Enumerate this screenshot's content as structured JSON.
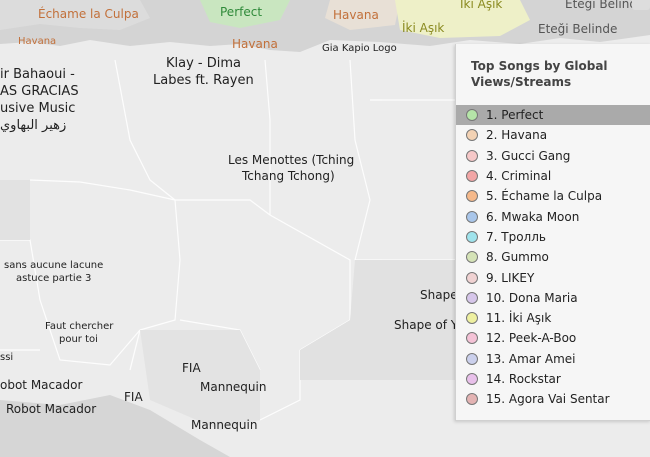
{
  "map_labels": [
    {
      "text": "Échame la Culpa",
      "color": "#c2703a"
    },
    {
      "text": "Perfect",
      "color": "#2f8a3a"
    },
    {
      "text": "Havana",
      "color": "#c2703a"
    },
    {
      "text": "İki Aşık",
      "color": "#8a8a20"
    },
    {
      "text": "Eteği Belinde",
      "color": "#555555"
    },
    {
      "text": "İki Aşık",
      "color": "#8a8a20"
    },
    {
      "text": "Eteği Belinde",
      "color": "#555555"
    },
    {
      "text": "Havana",
      "color": "#c2703a"
    },
    {
      "text": "Havana",
      "color": "#c2703a"
    },
    {
      "text": "Gia Kapio Logo",
      "color": "#222222"
    },
    {
      "text": "Klay - Dima",
      "color": "#222222"
    },
    {
      "text": "Labes ft. Rayen",
      "color": "#222222"
    },
    {
      "text": "ir Bahaoui -",
      "color": "#222222"
    },
    {
      "text": "AS GRACIAS",
      "color": "#222222"
    },
    {
      "text": "usive Music",
      "color": "#222222"
    },
    {
      "text": "زهير البهاوي",
      "color": "#222222"
    },
    {
      "text": "Les Menottes (Tching",
      "color": "#222222"
    },
    {
      "text": "Tchang Tchong)",
      "color": "#222222"
    },
    {
      "text": "sans aucune lacune",
      "color": "#222222"
    },
    {
      "text": "astuce partie 3",
      "color": "#222222"
    },
    {
      "text": "Faut chercher",
      "color": "#222222"
    },
    {
      "text": "pour toi",
      "color": "#222222"
    },
    {
      "text": "ssi",
      "color": "#222222"
    },
    {
      "text": "obot Macador",
      "color": "#222222"
    },
    {
      "text": "Robot Macador",
      "color": "#222222"
    },
    {
      "text": "FIA",
      "color": "#222222"
    },
    {
      "text": "FIA",
      "color": "#222222"
    },
    {
      "text": "Mannequin",
      "color": "#222222"
    },
    {
      "text": "Mannequin",
      "color": "#222222"
    },
    {
      "text": "Shape",
      "color": "#222222"
    },
    {
      "text": "Shape of Yo",
      "color": "#222222"
    }
  ],
  "panel": {
    "title": "Top Songs by Global Views/Streams",
    "items": [
      {
        "label": "1. Perfect",
        "color": "#b5e5a8",
        "selected": true
      },
      {
        "label": "2. Havana",
        "color": "#f3d2b4"
      },
      {
        "label": "3. Gucci Gang",
        "color": "#f6c8c8"
      },
      {
        "label": "4. Criminal",
        "color": "#f2a6a6"
      },
      {
        "label": "5. Échame la Culpa",
        "color": "#f5b98b"
      },
      {
        "label": "6. Mwaka Moon",
        "color": "#a9c6ea"
      },
      {
        "label": "7. Тролль",
        "color": "#9fe3ec"
      },
      {
        "label": "8. Gummo",
        "color": "#d5e3b7"
      },
      {
        "label": "9. LIKEY",
        "color": "#f0d2d2"
      },
      {
        "label": "10. Dona Maria",
        "color": "#d6c6ea"
      },
      {
        "label": "11. İki Aşık",
        "color": "#eef0a0"
      },
      {
        "label": "12. Peek-A-Boo",
        "color": "#f4c2d6"
      },
      {
        "label": "13. Amar Amei",
        "color": "#cbd0ec"
      },
      {
        "label": "14. Rockstar",
        "color": "#e8c0ea"
      },
      {
        "label": "15. Agora Vai Sentar",
        "color": "#e3b3b3"
      }
    ]
  }
}
